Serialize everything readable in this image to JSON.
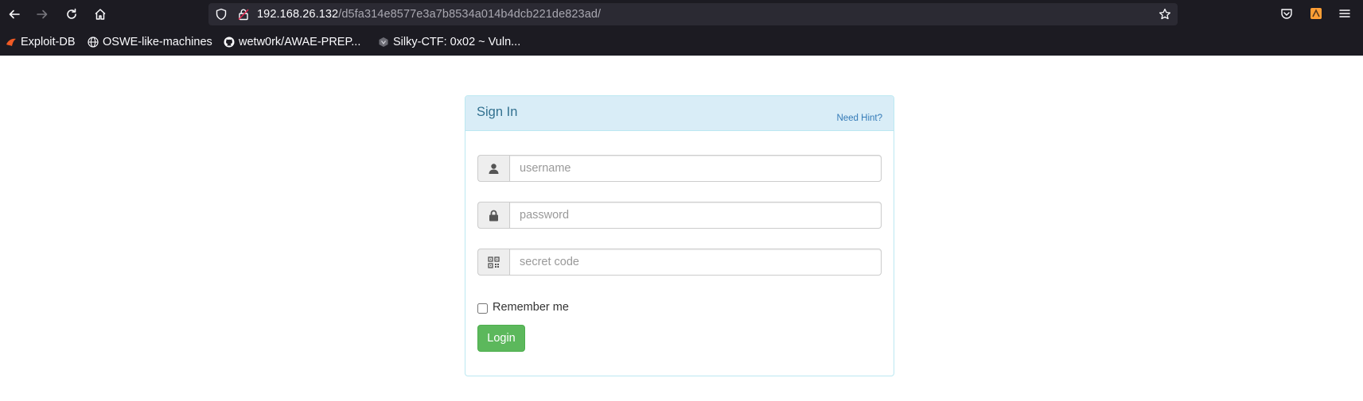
{
  "browser": {
    "url_host": "192.168.26.132",
    "url_path": "/d5fa314e8577e3a7b8534a014b4dcb221de823ad/",
    "bookmarks": [
      {
        "label": "Exploit-DB",
        "icon": "exploit-db-icon"
      },
      {
        "label": "OSWE-like-machines",
        "icon": "globe-icon"
      },
      {
        "label": "wetw0rk/AWAE-PREP...",
        "icon": "github-icon"
      },
      {
        "label": "Silky-CTF: 0x02 ~ Vuln...",
        "icon": "vulnhub-icon"
      }
    ],
    "colors": {
      "toolbar": "#1c1b22",
      "urlbar": "#2b2a33"
    }
  },
  "login_panel": {
    "title": "Sign In",
    "hint_link": "Need Hint?",
    "username_placeholder": "username",
    "password_placeholder": "password",
    "secret_placeholder": "secret code",
    "remember_label": "Remember me",
    "login_label": "Login",
    "colors": {
      "heading_bg": "#d9edf7",
      "title": "#31708f",
      "button": "#5cb85c"
    }
  }
}
